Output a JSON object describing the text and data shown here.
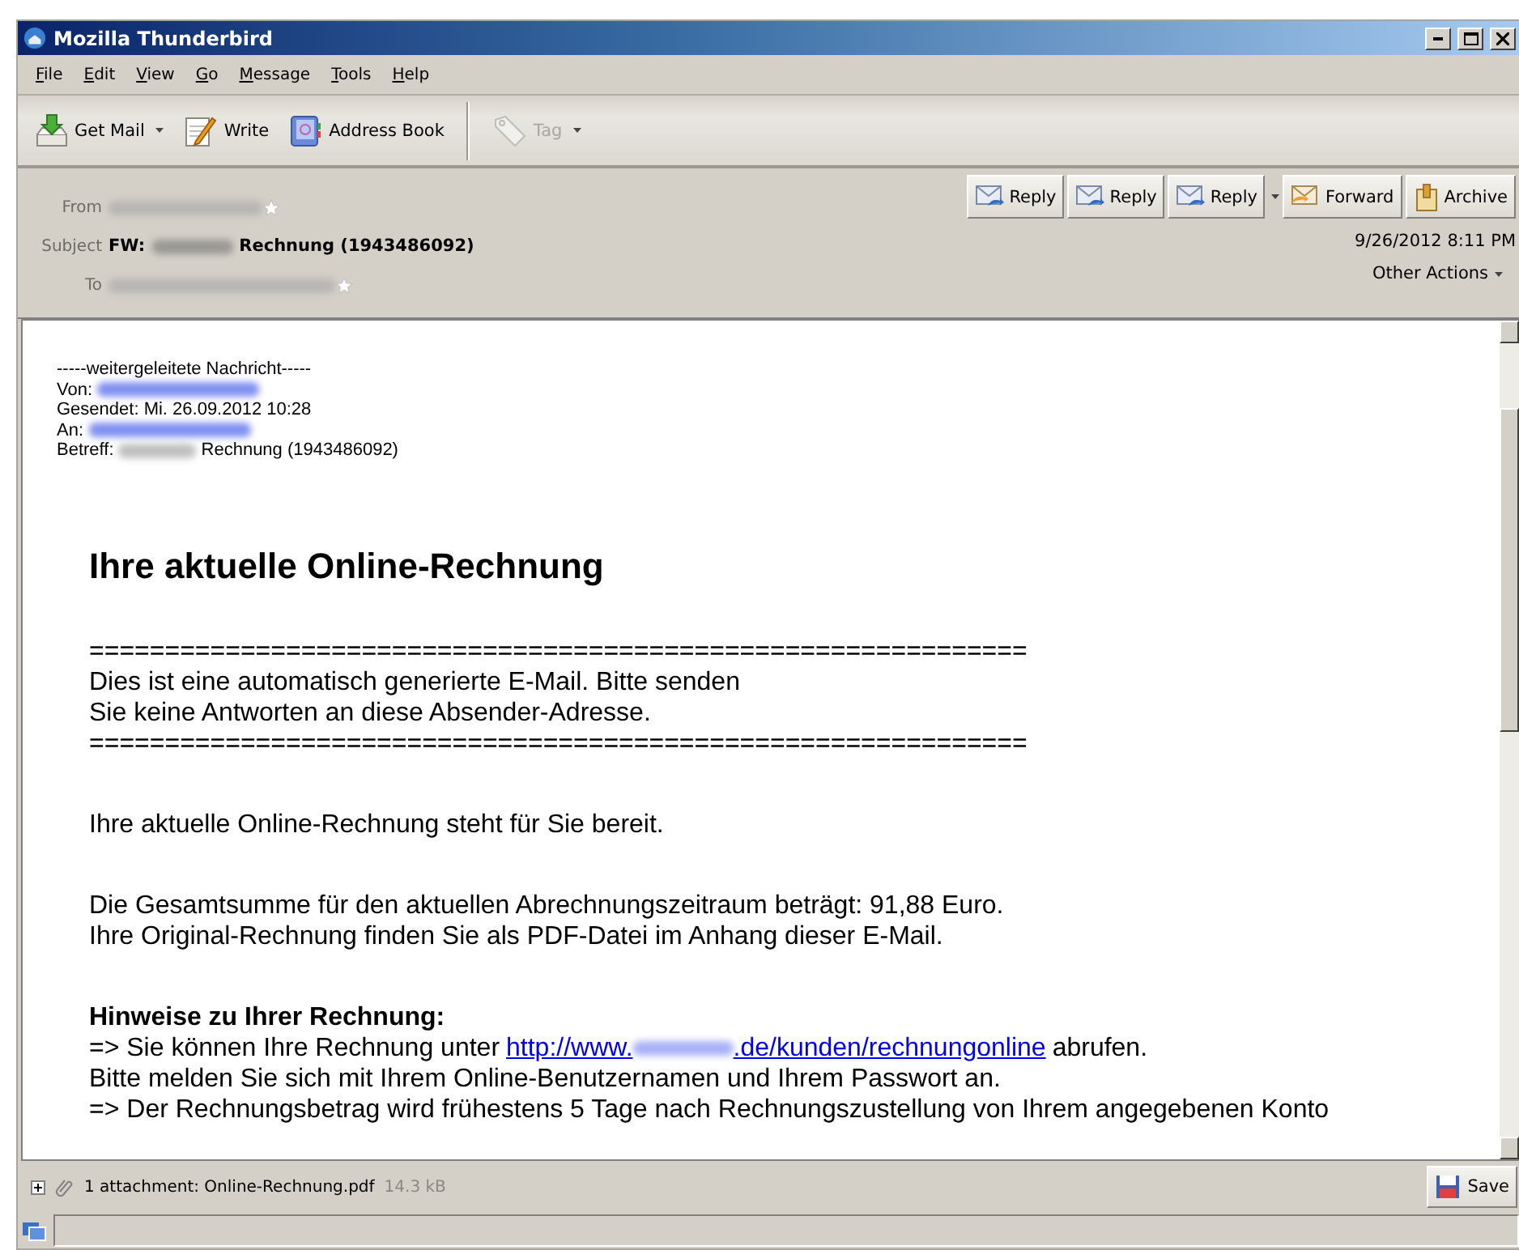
{
  "window": {
    "title": "Mozilla Thunderbird"
  },
  "menu": [
    "File",
    "Edit",
    "View",
    "Go",
    "Message",
    "Tools",
    "Help"
  ],
  "toolbar": [
    {
      "label": "Get Mail",
      "dropdown": true,
      "disabled": false
    },
    {
      "label": "Write",
      "dropdown": false,
      "disabled": false
    },
    {
      "label": "Address Book",
      "dropdown": false,
      "disabled": false
    },
    {
      "label": "Tag",
      "dropdown": true,
      "disabled": true
    }
  ],
  "header": {
    "from": {
      "label": "From",
      "redacted": true
    },
    "subject": {
      "label": "Subject",
      "prefix": "FW:",
      "redacted": true,
      "text": "Rechnung (1943486092)"
    },
    "to": {
      "label": "To",
      "redacted": true
    },
    "actions": [
      {
        "label": "Reply",
        "dropdown": false
      },
      {
        "label": "Reply",
        "dropdown": false
      },
      {
        "label": "Reply",
        "dropdown": true
      },
      {
        "label": "Forward",
        "dropdown": false
      },
      {
        "label": "Archive",
        "dropdown": false
      }
    ],
    "date": "9/26/2012 8:11 PM",
    "other_actions": "Other Actions"
  },
  "forwarded": [
    {
      "kind": "plain",
      "text": "-----weitergeleitete Nachricht-----"
    },
    {
      "kind": "link-redacted",
      "label": "Von:"
    },
    {
      "kind": "plain",
      "text": "Gesendet: Mi. 26.09.2012 10:28"
    },
    {
      "kind": "link-redacted",
      "label": "An:"
    },
    {
      "kind": "text-redacted",
      "label": "Betreff:",
      "text": "Rechnung (1943486092)"
    }
  ],
  "heading": "Ihre aktuelle Online-Rechnung",
  "blocks": [
    {
      "lines": [
        {
          "kind": "text",
          "text": "=============================================================="
        },
        {
          "kind": "text",
          "text": "Dies ist eine automatisch generierte E-Mail. Bitte senden"
        },
        {
          "kind": "text",
          "text": "Sie keine Antworten an diese Absender-Adresse."
        },
        {
          "kind": "text",
          "text": "=============================================================="
        }
      ]
    },
    {
      "lines": [
        {
          "kind": "text",
          "text": "Ihre aktuelle Online-Rechnung steht für Sie bereit."
        }
      ]
    },
    {
      "lines": [
        {
          "kind": "text",
          "text": "Die Gesamtsumme für den aktuellen Abrechnungszeitraum beträgt: 91,88 Euro."
        },
        {
          "kind": "text",
          "text": "Ihre Original-Rechnung finden Sie als PDF-Datei im Anhang dieser E-Mail."
        }
      ]
    },
    {
      "title": "Hinweise zu Ihrer Rechnung:",
      "lines": [
        {
          "kind": "link",
          "before": "=> Sie können Ihre Rechnung unter",
          "link_start": "http://www.",
          "link_end": ".de/kunden/rechnungonline",
          "after": "abrufen."
        },
        {
          "kind": "text",
          "text": "Bitte melden Sie sich mit Ihrem Online-Benutzernamen und Ihrem Passwort an."
        },
        {
          "kind": "text",
          "text": "=> Der Rechnungsbetrag wird frühestens 5 Tage nach Rechnungszustellung von Ihrem angegebenen Konto"
        }
      ]
    }
  ],
  "attachment": {
    "summary": "1 attachment: Online-Rechnung.pdf",
    "size": "14.3 kB",
    "save": "Save"
  }
}
